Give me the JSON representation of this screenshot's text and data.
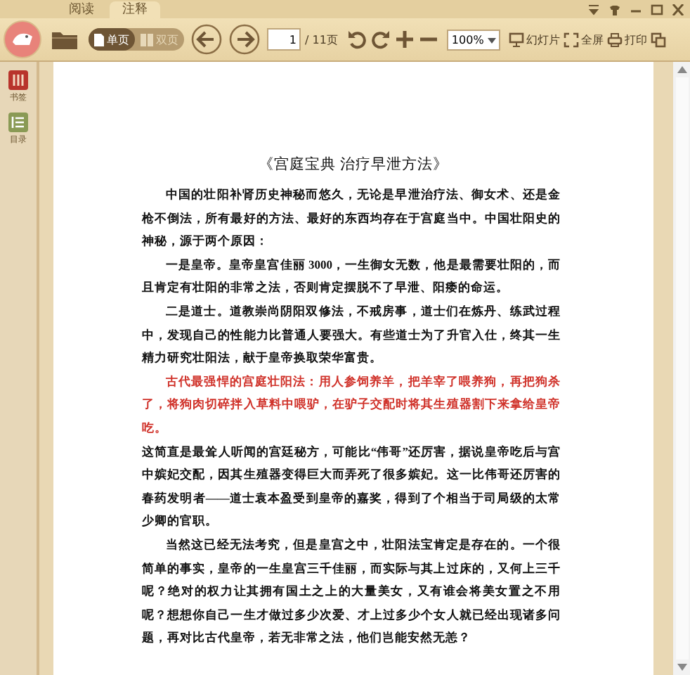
{
  "tabs": [
    {
      "label": "阅读",
      "selected": false
    },
    {
      "label": "注释",
      "selected": true
    }
  ],
  "toolbar": {
    "view_modes": [
      {
        "label": "单页",
        "selected": true
      },
      {
        "label": "双页",
        "selected": false
      }
    ],
    "page_input": "1",
    "page_total": "/ 11页",
    "zoom": "100%",
    "actions": [
      {
        "kind": "slideshow",
        "label": "幻灯片"
      },
      {
        "kind": "fullscreen",
        "label": "全屏"
      },
      {
        "kind": "print",
        "label": "打印"
      },
      {
        "kind": "copy"
      }
    ]
  },
  "sidebar": {
    "items": [
      {
        "kind": "bookmark",
        "label": "书签"
      },
      {
        "kind": "contents",
        "label": "目录"
      }
    ]
  },
  "document": {
    "title": "《宫庭宝典  治疗早泄方法》",
    "paragraphs": [
      {
        "parts": [
          {
            "text": "中国的壮阳补肾历史神秘而悠久，无论是早泄治疗法、御女术、还是金枪不倒法，所有最好的方法、最好的东西均存在于宫庭当中。中国壮阳史的神秘，源于两个原因：",
            "highlight": false
          }
        ]
      },
      {
        "parts": [
          {
            "text": "一是皇帝。皇帝皇宫佳丽 3000，一生御女无数，他是最需要壮阳的，而且肯定有壮阳的非常之法，否则肯定摆脱不了早泄、阳痿的命运。",
            "highlight": false
          }
        ]
      },
      {
        "parts": [
          {
            "text": "二是道士。道教崇尚阴阳双修法，不戒房事，道士们在炼丹、练武过程中，发现自己的性能力比普通人要强大。有些道士为了升官入仕，终其一生精力研究壮阳法，献于皇帝换取荣华富贵。",
            "highlight": false
          }
        ]
      },
      {
        "parts": [
          {
            "text": "古代最强悍的宫庭壮阳法：用人参饲养羊，把羊宰了喂养狗，再把狗杀了，将狗肉切碎拌入草料中喂驴，在驴子交配时将其生殖器割下来拿给皇帝吃。",
            "highlight": true
          },
          {
            "text": "这简直是最耸人听闻的宫廷秘方，可能比“伟哥”还厉害，据说皇帝吃后与宫中嫔妃交配，因其生殖器变得巨大而弄死了很多嫔妃。这一比伟哥还厉害的春药发明者——道士袁本盈受到皇帝的嘉奖，得到了个相当于司局级的太常少卿的官职。",
            "highlight": false
          }
        ]
      },
      {
        "parts": [
          {
            "text": "当然这已经无法考究，但是皇宫之中，壮阳法宝肯定是存在的。一个很简单的事实，皇帝的一生皇宫三千佳丽，而实际与其上过床的，又何上三千呢？绝对的权力让其拥有国土之上的大量美女，又有谁会将美女置之不用呢？想想你自己一生才做过多少次爱、才上过多少个女人就已经出现诸多问题，再对比古代皇帝，若无非常之法，他们岂能安然无恙？",
            "highlight": false
          }
        ]
      }
    ]
  }
}
